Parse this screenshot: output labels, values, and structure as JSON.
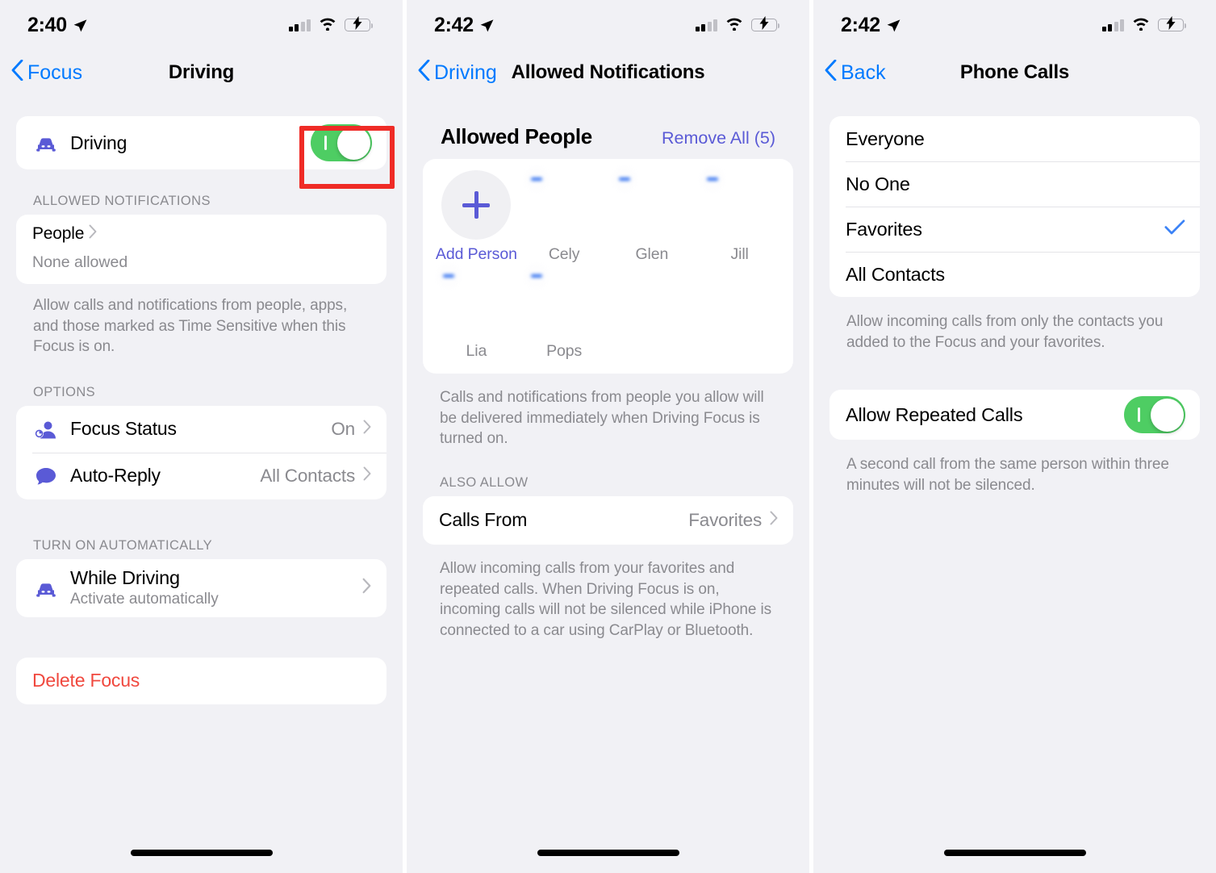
{
  "theme": {
    "accent_blue": "#007aff",
    "accent_indigo": "#5a5ad6",
    "toggle_green": "#4ecd63",
    "destructive_red": "#f0483e",
    "highlight_red": "#ef2b26",
    "page_bg": "#f1f1f5",
    "card_bg": "#ffffff",
    "secondary_text": "#8a8a8f"
  },
  "screens": [
    {
      "id": "driving-focus",
      "status_bar": {
        "time": "2:40",
        "location_icon": "location-arrow-icon",
        "signal_icon": "cellular-bars-icon",
        "wifi_icon": "wifi-icon",
        "battery_icon": "battery-charging-icon"
      },
      "nav": {
        "back_label": "Focus",
        "back_icon": "chevron-left-icon",
        "title": "Driving"
      },
      "toggle_row": {
        "icon": "car-icon",
        "label": "Driving",
        "value": "on",
        "highlighted": true
      },
      "allowed_notifications": {
        "header": "ALLOWED NOTIFICATIONS",
        "people_label": "People",
        "people_chevron": "chevron-right-icon",
        "people_sub": "None allowed",
        "footnote": "Allow calls and notifications from people, apps, and those marked as Time Sensitive when this Focus is on."
      },
      "options": {
        "header": "OPTIONS",
        "rows": [
          {
            "icon": "focus-status-icon",
            "label": "Focus Status",
            "value": "On",
            "chevron": "chevron-right-icon"
          },
          {
            "icon": "message-bubble-icon",
            "label": "Auto-Reply",
            "value": "All Contacts",
            "chevron": "chevron-right-icon"
          }
        ]
      },
      "turn_on_automatically": {
        "header": "TURN ON AUTOMATICALLY",
        "row": {
          "icon": "car-icon",
          "title": "While Driving",
          "subtitle": "Activate automatically",
          "chevron": "chevron-right-icon"
        }
      },
      "delete": {
        "label": "Delete Focus"
      },
      "home_indicator": true
    },
    {
      "id": "allowed-notifications",
      "status_bar": {
        "time": "2:42",
        "location_icon": "location-arrow-icon",
        "signal_icon": "cellular-bars-icon",
        "wifi_icon": "wifi-icon",
        "battery_icon": "battery-charging-icon"
      },
      "nav": {
        "back_label": "Driving",
        "back_icon": "chevron-left-icon",
        "title": "Allowed Notifications"
      },
      "allowed_people": {
        "title": "Allowed People",
        "remove_all": "Remove All (5)",
        "items": [
          {
            "name": "Add Person",
            "type": "add",
            "icon": "plus-icon",
            "accent": true
          },
          {
            "name": "Cely",
            "type": "person",
            "badge": "remove-minus-icon",
            "avatar_colors": [
              "#caa884",
              "#8f6d52",
              "#2b2018"
            ]
          },
          {
            "name": "Glen",
            "type": "person",
            "badge": "remove-minus-icon",
            "avatar_colors": [
              "#e4e6ee",
              "#c9c6c0",
              "#b3b0ad"
            ]
          },
          {
            "name": "Jill",
            "type": "person",
            "badge": "remove-minus-icon",
            "avatar_colors": [
              "#c08a6c",
              "#8d5b42",
              "#6d4532"
            ]
          },
          {
            "name": "Lia",
            "type": "person",
            "badge": "remove-minus-icon",
            "avatar_colors": [
              "#cf9a6b",
              "#8a5a34",
              "#241a12"
            ]
          },
          {
            "name": "Pops",
            "type": "person",
            "badge": "remove-minus-icon",
            "avatar_colors": [
              "#8c8ca8",
              "#5c4f6a",
              "#3a3340"
            ]
          }
        ],
        "footnote": "Calls and notifications from people you allow will be delivered immediately when Driving Focus is turned on."
      },
      "also_allow": {
        "header": "ALSO ALLOW",
        "row": {
          "label": "Calls From",
          "value": "Favorites",
          "chevron": "chevron-right-icon"
        },
        "footnote": "Allow incoming calls from your favorites and repeated calls. When Driving Focus is on, incoming calls will not be silenced while iPhone is connected to a car using CarPlay or Bluetooth."
      },
      "home_indicator": true
    },
    {
      "id": "phone-calls",
      "status_bar": {
        "time": "2:42",
        "location_icon": "location-arrow-icon",
        "signal_icon": "cellular-bars-icon",
        "wifi_icon": "wifi-icon",
        "battery_icon": "battery-charging-icon"
      },
      "nav": {
        "back_label": "Back",
        "back_icon": "chevron-left-icon",
        "title": "Phone Calls"
      },
      "options": [
        {
          "label": "Everyone",
          "selected": false
        },
        {
          "label": "No One",
          "selected": false
        },
        {
          "label": "Favorites",
          "selected": true,
          "check_icon": "checkmark-icon"
        },
        {
          "label": "All Contacts",
          "selected": false
        }
      ],
      "options_footnote": "Allow incoming calls from only the contacts you added to the Focus and your favorites.",
      "repeated_calls": {
        "label": "Allow Repeated Calls",
        "value": "on"
      },
      "repeated_footnote": "A second call from the same person within three minutes will not be silenced.",
      "home_indicator": true
    }
  ]
}
